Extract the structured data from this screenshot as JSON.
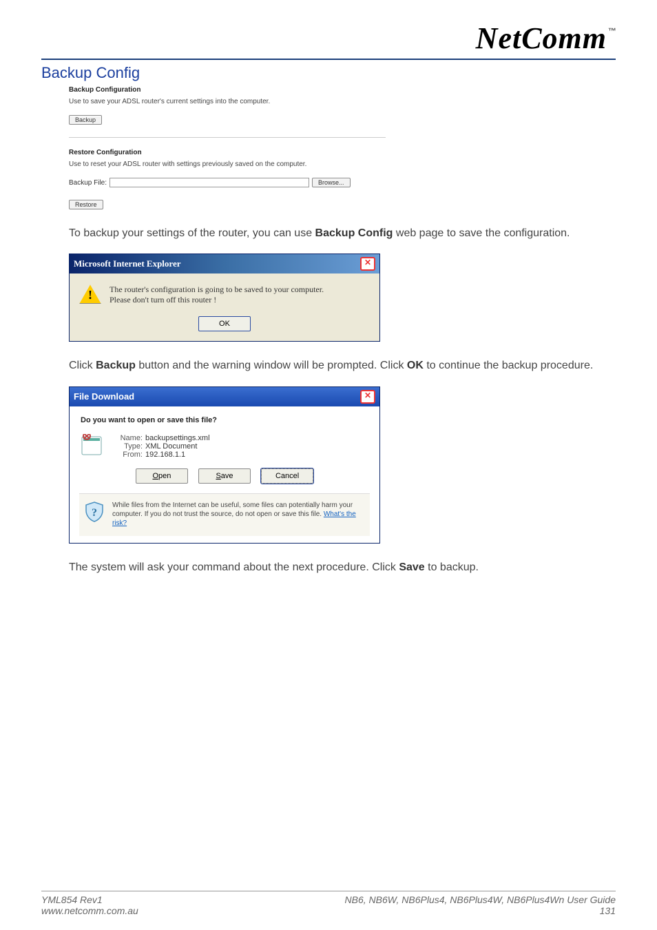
{
  "brand": "NetComm",
  "section_title": "Backup Config",
  "panel": {
    "backup_heading": "Backup Configuration",
    "backup_desc": "Use to save your ADSL router's current settings into the computer.",
    "backup_btn": "Backup",
    "restore_heading": "Restore Configuration",
    "restore_desc": "Use to reset your ADSL router with settings previously saved on the computer.",
    "restore_file_label": "Backup File:",
    "browse_btn": "Browse...",
    "restore_btn": "Restore"
  },
  "para1_pre": "To backup your settings of the router, you can use ",
  "para1_bold": "Backup Config",
  "para1_post": " web page to save the configuration.",
  "ie_alert": {
    "title": "Microsoft Internet Explorer",
    "msg_line1": "The router's configuration is going to be saved to your computer.",
    "msg_line2": "Please don't turn off this router !",
    "ok": "OK"
  },
  "para2_a": "Click ",
  "para2_b": "Backup",
  "para2_c": " button and the warning window will be prompted. Click ",
  "para2_d": "OK",
  "para2_e": " to continue the backup procedure.",
  "fd": {
    "title": "File Download",
    "question": "Do you want to open or save this file?",
    "name_label": "Name:",
    "name_value": "backupsettings.xml",
    "type_label": "Type:",
    "type_value": "XML Document",
    "from_label": "From:",
    "from_value": "192.168.1.1",
    "open_btn": "Open",
    "save_btn": "Save",
    "cancel_btn": "Cancel",
    "footer_text": "While files from the Internet can be useful, some files can potentially harm your computer. If you do not trust the source, do not open or save this file. ",
    "footer_link": "What's the risk?"
  },
  "para3_a": "The system will ask your command about the next procedure. Click ",
  "para3_b": "Save",
  "para3_c": " to backup.",
  "footer": {
    "left1": "YML854 Rev1",
    "left2": "www.netcomm.com.au",
    "right1_a": "NB6, NB6W, NB6Plus4, NB6Plus4W, NB6Plus4Wn ",
    "right1_b": "User Guide",
    "right2": "131"
  }
}
